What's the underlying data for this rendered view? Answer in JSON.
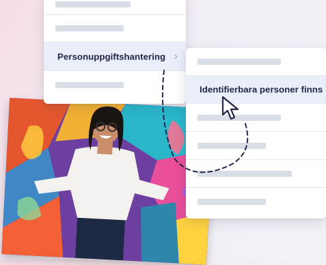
{
  "menu_primary": {
    "selected_label": "Personuppgiftshantering",
    "selected_chevron": "chevron-right-icon"
  },
  "menu_secondary": {
    "selected_label": "Identifierbara personer finns"
  },
  "pointer": "arrow-cursor-icon",
  "colors": {
    "label": "#22264a",
    "selected_row": "#e9eef8",
    "placeholder_bar": "#d9dde5"
  }
}
